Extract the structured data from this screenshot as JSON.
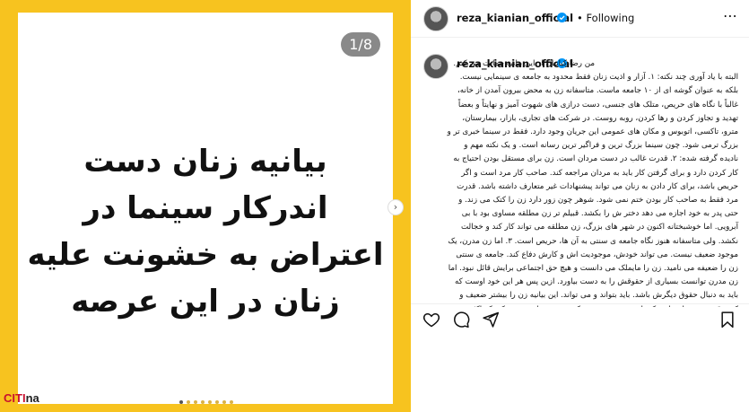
{
  "media": {
    "slide_text": "بیانیه زنان دست اندرکار سینما در اعتراض به خشونت علیه زنان در این عرصه",
    "counter": "1/8",
    "next_icon": "chevron-right-icon",
    "dots_total": 8,
    "dots_active": 1,
    "watermark_a": "CITI",
    "watermark_b": "na",
    "colors": {
      "background": "#f7c31f",
      "card": "#ffffff"
    }
  },
  "header": {
    "username": "reza_kianian_official",
    "separator": "•",
    "follow_label": "Following",
    "more_icon": "more-options-icon"
  },
  "caption": {
    "username": "reza_kianian_official",
    "text": "من رضا کیانیان از این بیانیه حمایت می کنم. البته با یاد آوری چند نکته: ۱. آزار و اذیت زنان فقط محدود به جامعه ی سینمایی نیست. بلکه به عنوان گوشه ای از ۱۰ جامعه ماست. متاسفانه زن به محض بیرون آمدن از خانه، غالباً با نگاه های حریص، متلک های جنسی، دست درازی های شهوت آمیز و نهایتاً و بعضاً تهدید و تجاوز کردن و رها کردن، روبه روست. در شرکت های تجاری، بازار، بیمارستان، مترو، تاکسی، اتوبوس و مکان های عمومی این جریان وجود دارد. فقط در سینما خبری تر و بزرگ ترمی شود. چون سینما بزرگ ترین و فراگیر ترین رسانه است. و یک نکته مهم و نادیده گرفته شده: ۲. قدرت غالب در دست مردان است. زن برای مستقل بودن احتیاج به کار کردن دارد و برای گرفتن کار باید به مردان مراجعه کند. صاحب کار مرد است و اگر حریص باشد، برای کار دادن به زنان می تواند پیشنهادات غیر متعارف داشته باشد. قدرت مرد فقط به صاحب کار بودن ختم نمی شود. شوهر چون زور دارد زن را کتک می زند. و حتی پدر به خود اجازه می دهد دختر ش را بکشد. قبیلم تر زن مطلقه مساوی بود با بی آبرویی. اما خوشبختانه اکنون در شهر های بزرگ، زن مطلقه می تواند کار کند و خجالت نکشد. ولی متاسفانه هنوز نگاه جامعه ی سنتی به آن ها، حریص است. ۳. اما زن مدرن، یک موجود ضعیف نیست. می تواند خودش، موجودیت اش و کارش دفاع کند. جامعه ی سنتی زن را ضعیفه می نامید. زن را مایملک می دانست و هیچ حق اجتماعی برایش قائل نبود. اما زن مدرن توانست بسیاری از حقوقش را به دست بیاورد. ازین پس هر این خود اوست که باید به دنبال حقوق دیگرش باشد. باید بتواند و می تواند. این بیانیه زن را بیشتر ضعیف و کمتر قدرتمند نشان داده، که باید تصحیح شود. و نکته ی مهم: باید تصریح کند که اکثریت مردان"
  },
  "actions": {
    "like_icon": "heart-icon",
    "comment_icon": "comment-icon",
    "share_icon": "share-icon",
    "save_icon": "bookmark-icon"
  }
}
